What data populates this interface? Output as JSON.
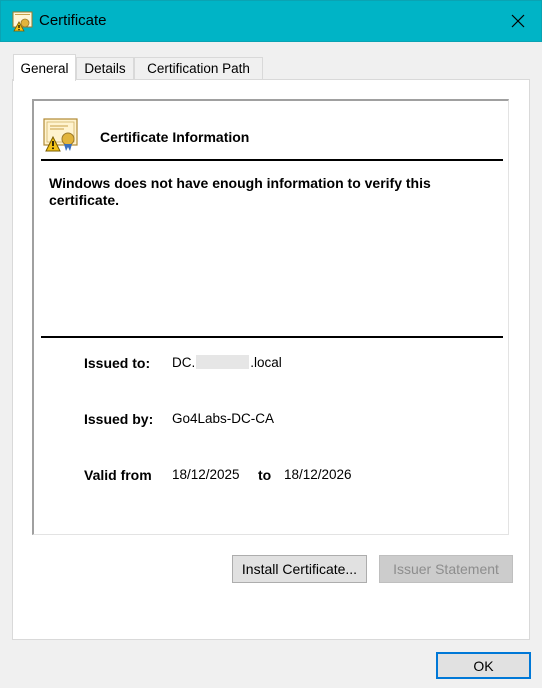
{
  "window": {
    "title": "Certificate",
    "close_icon": "close-icon",
    "app_icon": "certificate-warning-icon"
  },
  "tabs": [
    {
      "label": "General",
      "active": true
    },
    {
      "label": "Details",
      "active": false
    },
    {
      "label": "Certification Path",
      "active": false
    }
  ],
  "info": {
    "header": "Certificate Information",
    "warning": "Windows does not have enough information to verify this certificate.",
    "issued_to_label": "Issued to:",
    "issued_to_prefix": "DC.",
    "issued_to_suffix": ".local",
    "issued_by_label": "Issued by:",
    "issued_by_value": "Go4Labs-DC-CA",
    "valid_from_label": "Valid from",
    "valid_from": "18/12/2025",
    "to_label": "to",
    "valid_to": "18/12/2026"
  },
  "buttons": {
    "install": "Install Certificate...",
    "issuer_statement": "Issuer Statement",
    "ok": "OK"
  },
  "colors": {
    "titlebar": "#00b4c6",
    "accent_border": "#0078d7"
  }
}
